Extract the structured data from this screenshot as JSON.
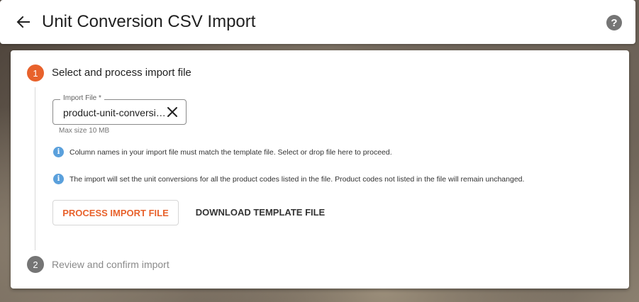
{
  "header": {
    "title": "Unit Conversion CSV Import",
    "back_icon": "arrow-left-icon",
    "help_icon": "help-circle-icon",
    "help_glyph": "?"
  },
  "steps": [
    {
      "number": "1",
      "label": "Select and process import file",
      "state": "active"
    },
    {
      "number": "2",
      "label": "Review and confirm import",
      "state": "inactive"
    }
  ],
  "import_file": {
    "label": "Import File *",
    "value": "product-unit-conversions.csv",
    "hint": "Max size 10 MB",
    "clear_icon": "close-icon"
  },
  "info_messages": [
    "Column names in your import file must match the template file. Select or drop file here to proceed.",
    "The import will set the unit conversions for all the product codes listed in the file. Product codes not listed in the file will remain unchanged."
  ],
  "info_icon_glyph": "i",
  "actions": {
    "process_label": "PROCESS IMPORT FILE",
    "download_label": "DOWNLOAD TEMPLATE FILE"
  },
  "colors": {
    "accent": "#e8622c",
    "info": "#5aa0dc",
    "inactive": "#757575"
  }
}
